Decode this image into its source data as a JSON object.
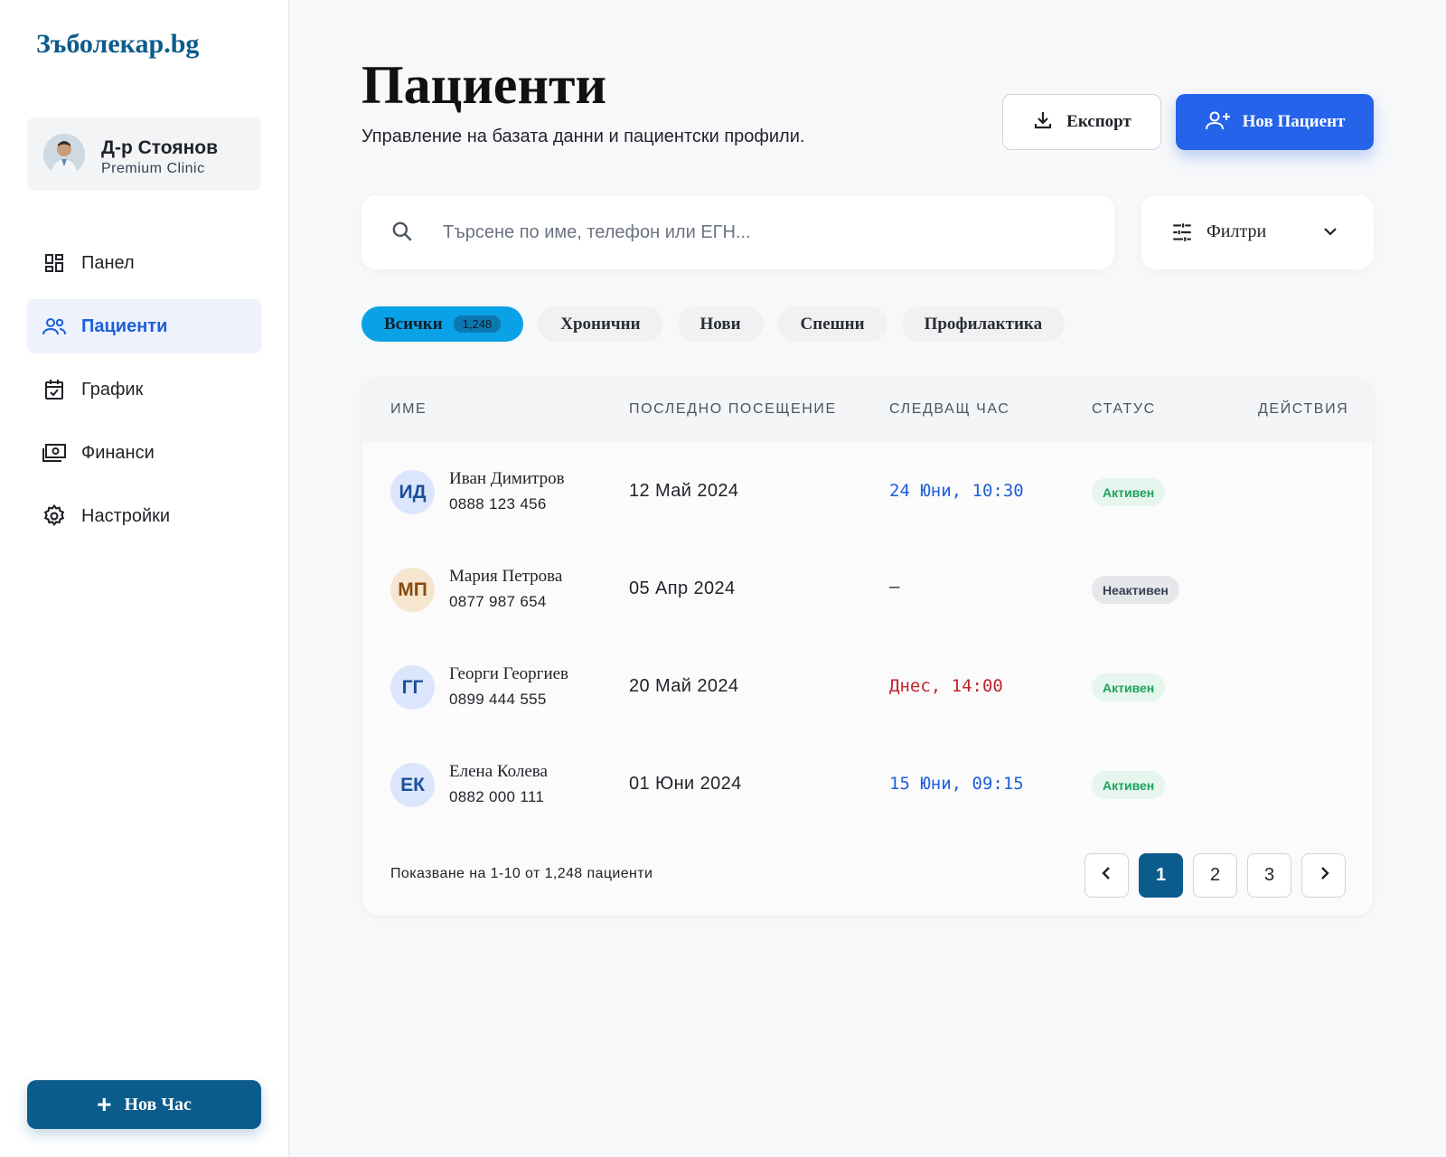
{
  "brand": {
    "logo": "Зъболекар.bg"
  },
  "profile": {
    "name": "Д-р Стоянов",
    "clinic": "Premium Clinic"
  },
  "nav": [
    {
      "label": "Панел",
      "icon": "dashboard-icon",
      "active": false
    },
    {
      "label": "Пациенти",
      "icon": "users-icon",
      "active": true
    },
    {
      "label": "График",
      "icon": "calendar-check-icon",
      "active": false
    },
    {
      "label": "Финанси",
      "icon": "money-icon",
      "active": false
    },
    {
      "label": "Настройки",
      "icon": "gear-icon",
      "active": false
    }
  ],
  "sidebar_action": {
    "label": "Нов Час"
  },
  "header": {
    "title": "Пациенти",
    "subtitle": "Управление на базата данни и пациентски профили.",
    "export_label": "Експорт",
    "new_patient_label": "Нов Пациент"
  },
  "search": {
    "placeholder": "Търсене по име, телефон или ЕГН...",
    "value": ""
  },
  "filters": {
    "label": "Филтри"
  },
  "chips": [
    {
      "label": "Всички",
      "count": "1,248",
      "active": true
    },
    {
      "label": "Хронични"
    },
    {
      "label": "Нови"
    },
    {
      "label": "Спешни"
    },
    {
      "label": "Профилактика"
    }
  ],
  "table": {
    "columns": [
      "ИМЕ",
      "ПОСЛЕДНО ПОСЕЩЕНИЕ",
      "СЛЕДВАЩ ЧАС",
      "СТАТУС",
      "ДЕЙСТВИЯ"
    ],
    "rows": [
      {
        "initials": "ИД",
        "name": "Иван Димитров",
        "phone": "0888 123 456",
        "last_visit": "12 Май 2024",
        "next": "24 Юни, 10:30",
        "status": "Активен"
      },
      {
        "initials": "МП",
        "name": "Мария Петрова",
        "phone": "0877 987 654",
        "last_visit": "05 Апр 2024",
        "next": "–",
        "status": "Неактивен"
      },
      {
        "initials": "ГГ",
        "name": "Георги Георгиев",
        "phone": "0899 444 555",
        "last_visit": "20 Май 2024",
        "next": "Днес, 14:00",
        "status": "Активен"
      },
      {
        "initials": "ЕК",
        "name": "Елена Колева",
        "phone": "0882 000 111",
        "last_visit": "01 Юни 2024",
        "next": "15 Юни, 09:15",
        "status": "Активен"
      }
    ],
    "footer": "Показване на 1-10 от 1,248 пациенти",
    "pages": [
      "1",
      "2",
      "3"
    ],
    "current_page": "1"
  },
  "colors": {
    "accent": "#2563eb",
    "brand": "#0b5b8c",
    "next_normal": "#1d5fd8",
    "next_today": "#c0262d",
    "active_badge": "#1ea35b"
  }
}
